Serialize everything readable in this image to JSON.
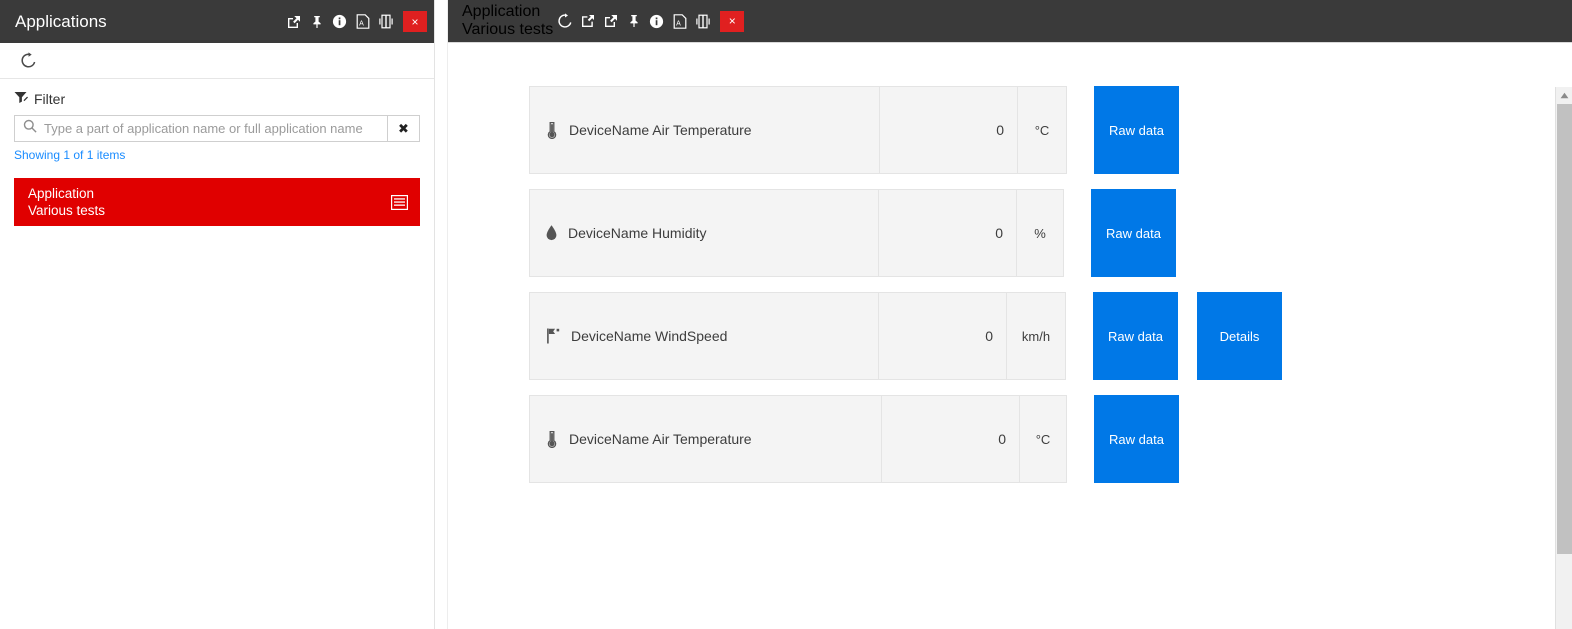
{
  "colors": {
    "header_bg": "#3a3a3a",
    "accent_red": "#e00000",
    "accent_blue": "#0078e7",
    "link_blue": "#1a8cff",
    "row_bg": "#f4f4f4"
  },
  "left_panel": {
    "header": {
      "title": "Applications",
      "icons": [
        {
          "name": "popout-window-icon",
          "glyph": "popout"
        },
        {
          "name": "pin-icon",
          "glyph": "pin"
        },
        {
          "name": "info-icon",
          "glyph": "info"
        },
        {
          "name": "pdf-export-icon",
          "glyph": "pdf"
        },
        {
          "name": "split-view-icon",
          "glyph": "split"
        }
      ],
      "close_label": "×"
    },
    "toolbar": {
      "refresh_icon": "refresh-icon"
    },
    "filter": {
      "label": "Filter",
      "icon": "filter-icon",
      "search_placeholder": "Type a part of application name or full application name",
      "search_value": "",
      "clear_label": "✖",
      "showing_text": "Showing 1 of 1 items"
    },
    "app_list": [
      {
        "title": "Application",
        "subtitle": "Various tests",
        "icon": "list-view-icon",
        "selected": true
      }
    ]
  },
  "right_panel": {
    "header": {
      "title": "Application",
      "subtitle": "Various tests",
      "icons": [
        {
          "name": "refresh-icon",
          "glyph": "refresh"
        },
        {
          "name": "open-external-icon",
          "glyph": "external"
        },
        {
          "name": "popout-window-icon",
          "glyph": "popout"
        },
        {
          "name": "pin-icon",
          "glyph": "pin"
        },
        {
          "name": "info-icon",
          "glyph": "info"
        },
        {
          "name": "pdf-export-icon",
          "glyph": "pdf"
        },
        {
          "name": "split-view-icon",
          "glyph": "split"
        }
      ],
      "close_label": "×"
    },
    "device_rows": [
      {
        "icon": "thermometer-icon",
        "name": "DeviceName Air Temperature",
        "value": "0",
        "unit": "°C",
        "name_width": 350,
        "value_width": 138,
        "unit_width": 48,
        "actions": [
          {
            "label": "Raw data",
            "name": "raw-data-button"
          }
        ]
      },
      {
        "icon": "droplet-icon",
        "name": "DeviceName Humidity",
        "value": "0",
        "unit": "%",
        "name_width": 349,
        "value_width": 138,
        "unit_width": 46,
        "actions": [
          {
            "label": "Raw data",
            "name": "raw-data-button"
          }
        ]
      },
      {
        "icon": "wind-vane-icon",
        "name": "DeviceName WindSpeed",
        "value": "0",
        "unit": "km/h",
        "name_width": 349,
        "value_width": 128,
        "unit_width": 58,
        "actions": [
          {
            "label": "Raw data",
            "name": "raw-data-button"
          },
          {
            "label": "Details",
            "name": "details-button"
          }
        ]
      },
      {
        "icon": "thermometer-icon",
        "name": "DeviceName Air Temperature",
        "value": "0",
        "unit": "°C",
        "name_width": 352,
        "value_width": 138,
        "unit_width": 46,
        "actions": [
          {
            "label": "Raw data",
            "name": "raw-data-button"
          }
        ]
      }
    ],
    "scrollbar": {
      "up_arrow": "▲"
    }
  }
}
